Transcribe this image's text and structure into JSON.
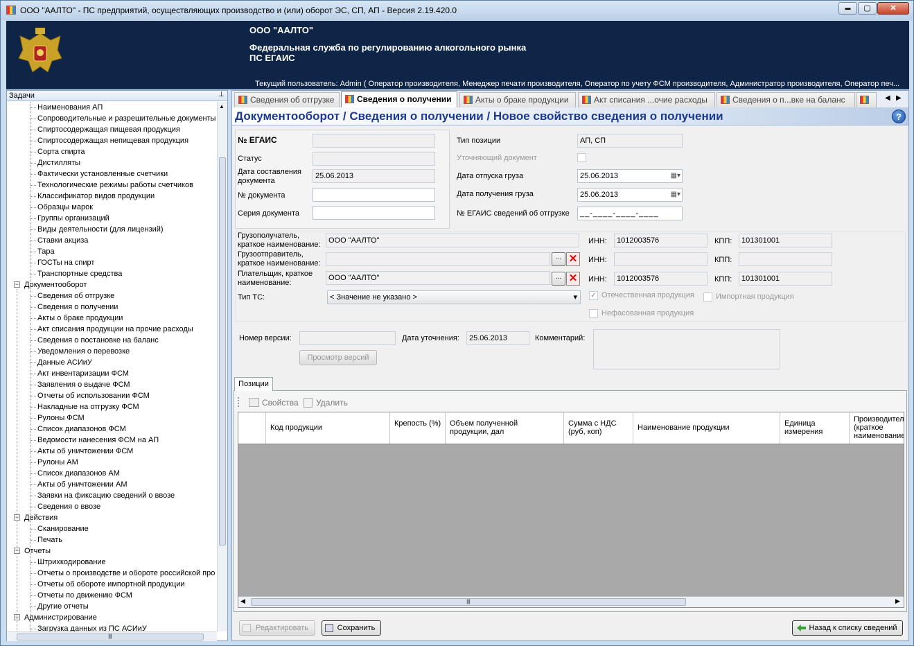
{
  "window": {
    "title": "ООО \"ААЛТО\" - ПС предприятий, осуществляющих производство и (или) оборот ЭС, СП, АП - Версия 2.19.420.0",
    "minimize": "▬",
    "maximize": "▢",
    "close": "✕"
  },
  "banner": {
    "org": "ООО \"ААЛТО\"",
    "service": "Федеральная служба по регулированию алкогольного рынка",
    "system": "ПС ЕГАИС",
    "user": "Текущий пользователь: Admin ( Оператор производителя, Менеджер печати производителя, Оператор по учету ФСМ производителя, Администратор производителя, Оператор печ..."
  },
  "sidebar": {
    "header": "Задачи",
    "pin": "⊥",
    "items": [
      {
        "label": "Наименования АП",
        "level": 2
      },
      {
        "label": "Сопроводительные и разрешительные документы",
        "level": 2
      },
      {
        "label": "Спиртосодержащая пищевая продукция",
        "level": 2
      },
      {
        "label": "Спиртосодержащая непищевая продукция",
        "level": 2
      },
      {
        "label": "Сорта спирта",
        "level": 2
      },
      {
        "label": "Дистилляты",
        "level": 2
      },
      {
        "label": "Фактически установленные счетчики",
        "level": 2
      },
      {
        "label": "Технологические режимы работы счетчиков",
        "level": 2
      },
      {
        "label": "Классификатор видов продукции",
        "level": 2
      },
      {
        "label": "Образцы марок",
        "level": 2
      },
      {
        "label": "Группы организаций",
        "level": 2
      },
      {
        "label": "Виды деятельности (для лицензий)",
        "level": 2
      },
      {
        "label": "Ставки акциза",
        "level": 2
      },
      {
        "label": "Тара",
        "level": 2
      },
      {
        "label": "ГОСТы на спирт",
        "level": 2
      },
      {
        "label": "Транспортные средства",
        "level": 2
      },
      {
        "label": "Документооборот",
        "level": 1
      },
      {
        "label": "Сведения об отгрузке",
        "level": 2
      },
      {
        "label": "Сведения о получении",
        "level": 2
      },
      {
        "label": "Акты о браке продукции",
        "level": 2
      },
      {
        "label": "Акт списания продукции на прочие расходы",
        "level": 2
      },
      {
        "label": "Сведения о постановке на баланс",
        "level": 2
      },
      {
        "label": "Уведомления о перевозке",
        "level": 2
      },
      {
        "label": "Данные АСИиУ",
        "level": 2
      },
      {
        "label": "Акт инвентаризации ФСМ",
        "level": 2
      },
      {
        "label": "Заявления о выдаче ФСМ",
        "level": 2
      },
      {
        "label": "Отчеты об использовании ФСМ",
        "level": 2
      },
      {
        "label": "Накладные на отгрузку ФСМ",
        "level": 2
      },
      {
        "label": "Рулоны ФСМ",
        "level": 2
      },
      {
        "label": "Список диапазонов ФСМ",
        "level": 2
      },
      {
        "label": "Ведомости нанесения ФСМ на АП",
        "level": 2
      },
      {
        "label": "Акты об уничтожении ФСМ",
        "level": 2
      },
      {
        "label": "Рулоны АМ",
        "level": 2
      },
      {
        "label": "Список диапазонов АМ",
        "level": 2
      },
      {
        "label": "Акты об уничтожении АМ",
        "level": 2
      },
      {
        "label": "Заявки на фиксацию сведений о ввозе",
        "level": 2
      },
      {
        "label": "Сведения о ввозе",
        "level": 2
      },
      {
        "label": "Действия",
        "level": 1
      },
      {
        "label": "Сканирование",
        "level": 2
      },
      {
        "label": "Печать",
        "level": 2
      },
      {
        "label": "Отчеты",
        "level": 1
      },
      {
        "label": "Штрихкодирование",
        "level": 2
      },
      {
        "label": "Отчеты о производстве и обороте российской про",
        "level": 2
      },
      {
        "label": "Отчеты об обороте импортной продукции",
        "level": 2
      },
      {
        "label": "Отчеты по движению ФСМ",
        "level": 2
      },
      {
        "label": "Другие отчеты",
        "level": 2
      },
      {
        "label": "Администрирование",
        "level": 1
      },
      {
        "label": "Загрузка данных из ПС АСИиУ",
        "level": 2
      }
    ],
    "expander": "−",
    "scroll_grip": "|||"
  },
  "tabs": [
    {
      "label": "Сведения об отгрузке",
      "active": false
    },
    {
      "label": "Сведения о получении",
      "active": true
    },
    {
      "label": "Акты о браке продукции",
      "active": false
    },
    {
      "label": "Акт списания ...очие расходы",
      "active": false
    },
    {
      "label": "Сведения о п...вке на баланс",
      "active": false
    }
  ],
  "tab_nav": {
    "prev": "◀",
    "next": "▶"
  },
  "doc_title": "Документооборот  / Сведения о получении / Новое свойство сведения о получении",
  "help": "?",
  "form": {
    "egais_no_label": "№ ЕГАИС",
    "egais_no": "",
    "status_label": "Статус",
    "status": "",
    "doc_date_label": "Дата составления документа",
    "doc_date": "25.06.2013",
    "doc_no_label": "№ документа",
    "doc_no": "",
    "doc_series_label": "Серия  документа",
    "doc_series": "",
    "pos_type_label": "Тип позиции",
    "pos_type": "АП, СП",
    "clarifying_label": "Уточняющий документ",
    "ship_date_label": "Дата отпуска груза",
    "ship_date": "25.06.2013",
    "recv_date_label": "Дата получения груза",
    "recv_date": "25.06.2013",
    "egais_ship_label": "№ ЕГАИС сведений об отгрузке",
    "egais_ship": "__-____-____-____",
    "consignee_label": "Грузополучатель, краткое наименование:",
    "consignee": "ООО \"ААЛТО\"",
    "consignee_inn": "1012003576",
    "consignee_kpp": "101301001",
    "shipper_label": "Грузоотправитель, краткое наименование:",
    "shipper": "",
    "shipper_inn": "",
    "shipper_kpp": "",
    "payer_label": "Плательщик, краткое наименование:",
    "payer": "ООО \"ААЛТО\"",
    "payer_inn": "1012003576",
    "payer_kpp": "101301001",
    "inn_label": "ИНН:",
    "kpp_label": "КПП:",
    "browse": "...",
    "clear": "✕",
    "ts_type_label": "Тип ТС:",
    "ts_type": "< Значение не указано >",
    "domestic_label": "Отечественная продукция",
    "import_label": "Импортная продукция",
    "unpacked_label": "Нефасованная продукция",
    "checked_mark": "✓",
    "version_label": "Номер версии:",
    "version": "",
    "clar_date_label": "Дата уточнения:",
    "clar_date": "25.06.2013",
    "comment_label": "Комментарий:",
    "comment": "",
    "view_versions": "Просмотр версий",
    "calendar_icon": "▦▾",
    "dropdown_icon": "▾"
  },
  "positions": {
    "tab": "Позиции",
    "props_btn": "Свойства",
    "delete_btn": "Удалить",
    "columns": [
      "Код продукции",
      "Крепость (%)",
      "Объем полученной продукции, дал",
      "Сумма с НДС (руб, коп)",
      "Наименование продукции",
      "Единица измерения",
      "Производитель (краткое наименование)"
    ],
    "rows": [],
    "scroll_left": "◀",
    "scroll_right": "▶",
    "scroll_grip": "|||"
  },
  "footer": {
    "edit": "Редактировать",
    "save": "Сохранить",
    "back": "Назад к списку сведений"
  }
}
